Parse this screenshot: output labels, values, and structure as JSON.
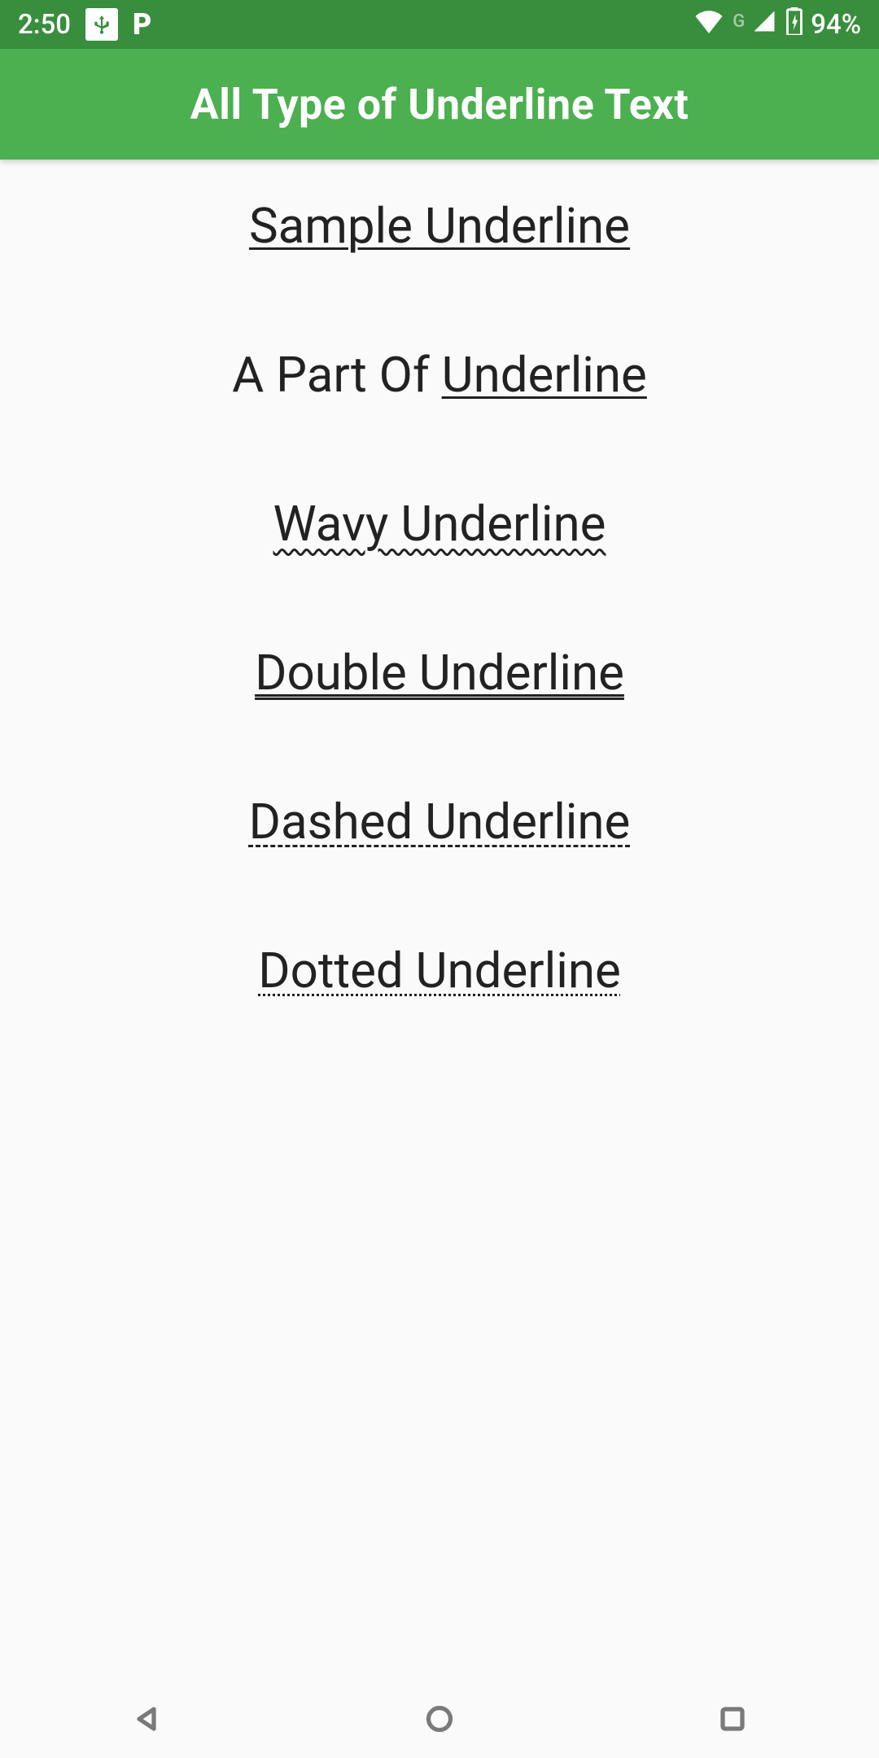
{
  "status": {
    "time": "2:50",
    "network_label": "G",
    "battery_percent": "94%"
  },
  "appbar": {
    "title": "All Type of Underline Text"
  },
  "examples": {
    "sample": "Sample Underline",
    "partial_prefix": "A Part Of ",
    "partial_underlined": "Underline",
    "wavy": "Wavy Underline",
    "double": "Double Underline",
    "dashed": "Dashed Underline",
    "dotted": "Dotted Underline"
  }
}
